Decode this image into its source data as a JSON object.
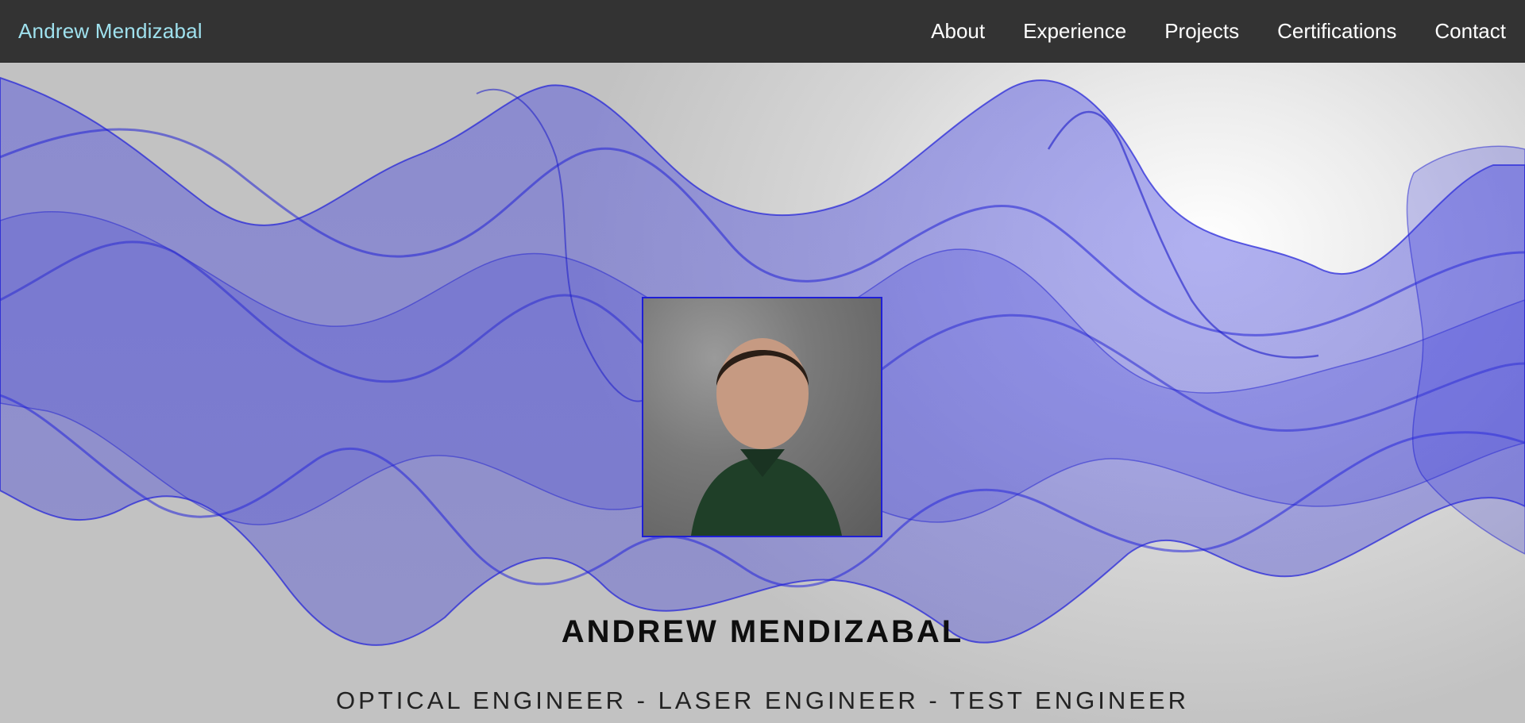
{
  "navbar": {
    "brand": "Andrew Mendizabal",
    "links": [
      {
        "label": "About"
      },
      {
        "label": "Experience"
      },
      {
        "label": "Projects"
      },
      {
        "label": "Certifications"
      },
      {
        "label": "Contact"
      }
    ]
  },
  "hero": {
    "name": "ANDREW MENDIZABAL",
    "tagline": "OPTICAL ENGINEER - LASER ENGINEER - TEST ENGINEER"
  },
  "colors": {
    "navbar_bg": "#333333",
    "brand": "#9fe1ee",
    "wave_accent": "#2020d8"
  }
}
